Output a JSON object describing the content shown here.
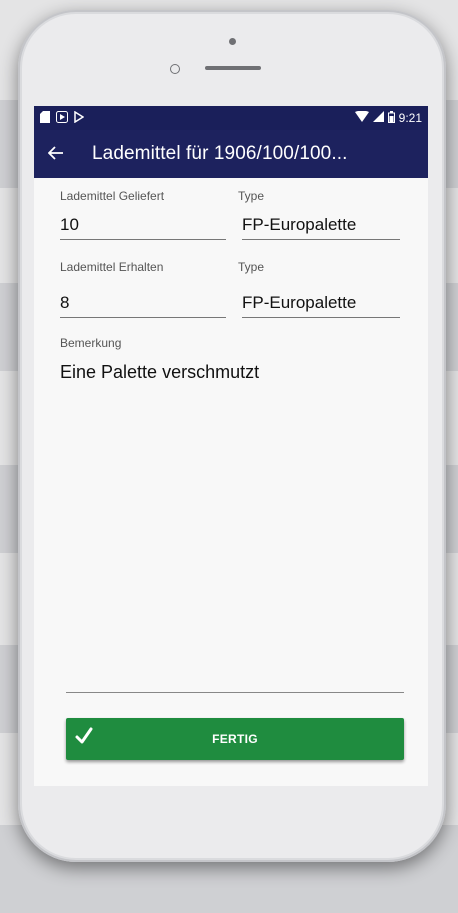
{
  "status_bar": {
    "left_icons": [
      "sim-card-icon",
      "play-store-icon",
      "play-icon"
    ],
    "right_icons": [
      "wifi-icon",
      "signal-icon",
      "battery-icon"
    ],
    "time": "9:21"
  },
  "app_bar": {
    "back_icon": "arrow-left-icon",
    "title": "Lademittel für 1906/100/100..."
  },
  "form": {
    "delivered": {
      "label": "Lademittel Geliefert",
      "value": "10"
    },
    "delivered_type": {
      "label": "Type",
      "value": "FP-Europalette"
    },
    "received": {
      "label": "Lademittel Erhalten",
      "value": "8"
    },
    "received_type": {
      "label": "Type",
      "value": "FP-Europalette"
    },
    "remark": {
      "label": "Bemerkung",
      "value": "Eine Palette verschmutzt"
    }
  },
  "button": {
    "label": "FERTIG",
    "icon": "checkmark-icon"
  },
  "colors": {
    "primary_dark": "#1a1f5a",
    "primary": "#1d225e",
    "accent_green": "#1f8c3f",
    "screen_bg": "#f8f8f8"
  }
}
